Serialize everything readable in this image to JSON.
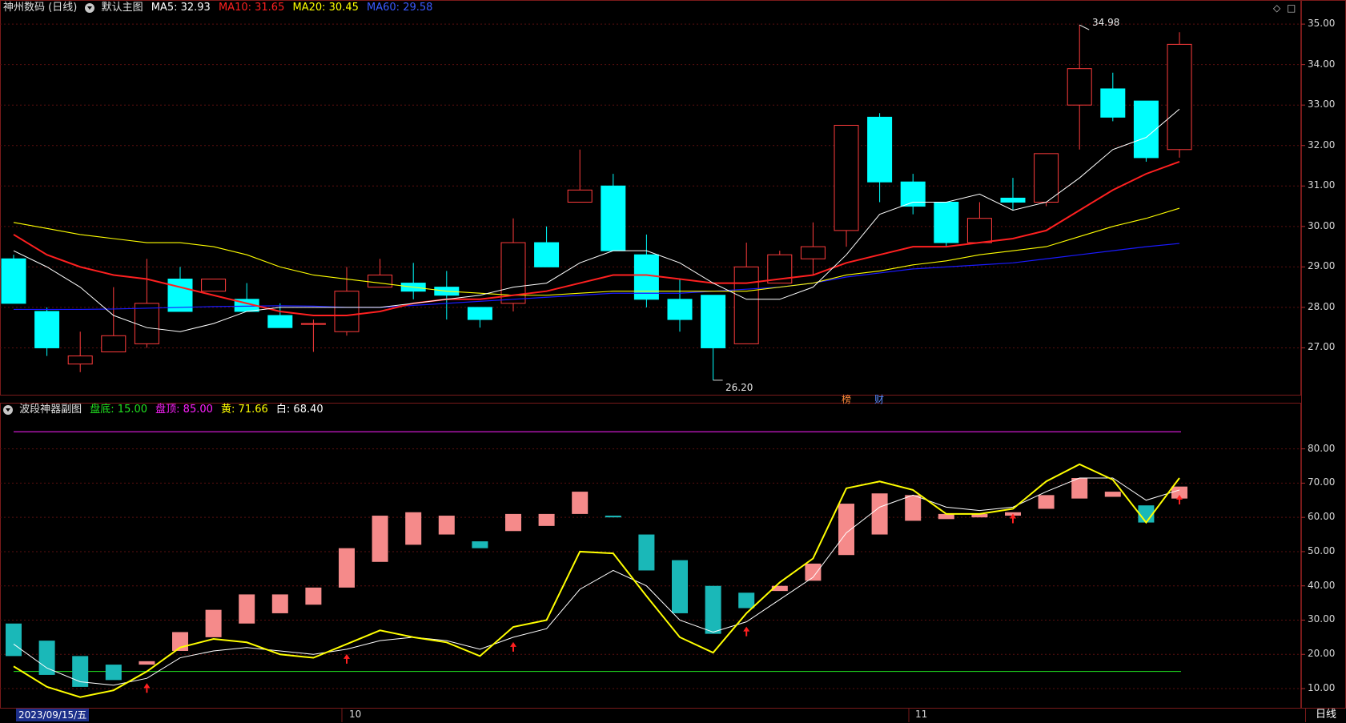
{
  "main_header": {
    "title": "神州数码 (日线)",
    "indicator_name": "默认主图",
    "ma5": {
      "label": "MA5: 32.93",
      "color": "#ffffff"
    },
    "ma10": {
      "label": "MA10: 31.65",
      "color": "#ff2020"
    },
    "ma20": {
      "label": "MA20: 30.45",
      "color": "#ffff00"
    },
    "ma60": {
      "label": "MA60: 29.58",
      "color": "#1a1aff"
    }
  },
  "sub_header": {
    "title": "波段神器副图",
    "bottom": {
      "label": "盘底: 15.00",
      "color": "#20e020"
    },
    "top": {
      "label": "盘顶: 85.00",
      "color": "#ff20ff"
    },
    "yellow": {
      "label": "黄: 71.66",
      "color": "#ffff00"
    },
    "white": {
      "label": "白: 68.40",
      "color": "#ffffff"
    }
  },
  "main_axis_labels": [
    "35.00",
    "34.00",
    "33.00",
    "32.00",
    "31.00",
    "30.00",
    "29.00",
    "28.00",
    "27.00"
  ],
  "sub_axis_labels": [
    "80.00",
    "70.00",
    "60.00",
    "50.00",
    "40.00",
    "30.00",
    "20.00",
    "10.00"
  ],
  "annotations": {
    "high": "34.98",
    "low": "26.20",
    "tag1": "榜",
    "tag2": "财"
  },
  "x_axis": {
    "date_cursor": "2023/09/15/五",
    "month_oct": "10",
    "month_nov": "11"
  },
  "period_button": "日线",
  "corner_icons": [
    "◇",
    "□"
  ],
  "chart_data": [
    {
      "type": "candlestick",
      "candles": [
        {
          "o": 29.2,
          "h": 29.3,
          "l": 28.1,
          "c": 28.1
        },
        {
          "o": 27.9,
          "h": 28.0,
          "l": 26.8,
          "c": 27.0
        },
        {
          "o": 26.6,
          "h": 27.4,
          "l": 26.4,
          "c": 26.8
        },
        {
          "o": 26.9,
          "h": 28.5,
          "l": 26.9,
          "c": 27.3
        },
        {
          "o": 27.1,
          "h": 29.2,
          "l": 27.0,
          "c": 28.1
        },
        {
          "o": 28.7,
          "h": 29.0,
          "l": 27.9,
          "c": 27.9
        },
        {
          "o": 28.4,
          "h": 28.7,
          "l": 28.4,
          "c": 28.7
        },
        {
          "o": 28.2,
          "h": 28.6,
          "l": 27.9,
          "c": 27.9
        },
        {
          "o": 27.8,
          "h": 28.1,
          "l": 27.5,
          "c": 27.5
        },
        {
          "o": 27.6,
          "h": 27.7,
          "l": 26.9,
          "c": 27.6
        },
        {
          "o": 27.4,
          "h": 29.0,
          "l": 27.3,
          "c": 28.4
        },
        {
          "o": 28.5,
          "h": 29.2,
          "l": 28.5,
          "c": 28.8
        },
        {
          "o": 28.6,
          "h": 29.1,
          "l": 28.2,
          "c": 28.4
        },
        {
          "o": 28.5,
          "h": 28.9,
          "l": 27.7,
          "c": 28.3
        },
        {
          "o": 28.0,
          "h": 28.0,
          "l": 27.5,
          "c": 27.7
        },
        {
          "o": 28.1,
          "h": 30.2,
          "l": 27.9,
          "c": 29.6
        },
        {
          "o": 29.6,
          "h": 30.0,
          "l": 29.0,
          "c": 29.0
        },
        {
          "o": 30.6,
          "h": 31.9,
          "l": 30.6,
          "c": 30.9
        },
        {
          "o": 31.0,
          "h": 31.3,
          "l": 29.4,
          "c": 29.4
        },
        {
          "o": 29.3,
          "h": 29.8,
          "l": 28.0,
          "c": 28.2
        },
        {
          "o": 28.2,
          "h": 28.7,
          "l": 27.4,
          "c": 27.7
        },
        {
          "o": 28.3,
          "h": 28.3,
          "l": 26.2,
          "c": 27.0
        },
        {
          "o": 27.1,
          "h": 29.6,
          "l": 27.1,
          "c": 29.0
        },
        {
          "o": 28.6,
          "h": 29.4,
          "l": 28.6,
          "c": 29.3
        },
        {
          "o": 29.2,
          "h": 30.1,
          "l": 28.8,
          "c": 29.5
        },
        {
          "o": 29.9,
          "h": 32.3,
          "l": 29.5,
          "c": 32.5
        },
        {
          "o": 32.7,
          "h": 32.8,
          "l": 30.6,
          "c": 31.1
        },
        {
          "o": 31.1,
          "h": 31.3,
          "l": 30.3,
          "c": 30.5
        },
        {
          "o": 30.6,
          "h": 30.6,
          "l": 29.5,
          "c": 29.6
        },
        {
          "o": 29.6,
          "h": 30.6,
          "l": 29.6,
          "c": 30.2
        },
        {
          "o": 30.7,
          "h": 31.2,
          "l": 30.4,
          "c": 30.6
        },
        {
          "o": 30.6,
          "h": 31.8,
          "l": 30.5,
          "c": 31.8
        },
        {
          "o": 33.0,
          "h": 34.98,
          "l": 31.9,
          "c": 33.9
        },
        {
          "o": 33.4,
          "h": 33.8,
          "l": 32.6,
          "c": 32.7
        },
        {
          "o": 33.1,
          "h": 33.1,
          "l": 31.6,
          "c": 31.7
        },
        {
          "o": 31.9,
          "h": 34.8,
          "l": 31.7,
          "c": 34.5
        }
      ],
      "ma5": [
        29.4,
        29.0,
        28.5,
        27.8,
        27.5,
        27.4,
        27.6,
        27.9,
        28.0,
        28.0,
        28.0,
        28.0,
        28.1,
        28.2,
        28.3,
        28.5,
        28.6,
        29.1,
        29.4,
        29.4,
        29.1,
        28.6,
        28.2,
        28.2,
        28.5,
        29.3,
        30.3,
        30.6,
        30.6,
        30.8,
        30.4,
        30.6,
        31.2,
        31.9,
        32.2,
        32.9
      ],
      "ma10": [
        29.8,
        29.3,
        29.0,
        28.8,
        28.7,
        28.5,
        28.3,
        28.1,
        27.9,
        27.8,
        27.8,
        27.9,
        28.1,
        28.2,
        28.2,
        28.3,
        28.4,
        28.6,
        28.8,
        28.8,
        28.7,
        28.6,
        28.6,
        28.7,
        28.8,
        29.1,
        29.3,
        29.5,
        29.5,
        29.6,
        29.7,
        29.9,
        30.4,
        30.9,
        31.3,
        31.6
      ],
      "ma20": [
        30.1,
        29.95,
        29.8,
        29.7,
        29.6,
        29.6,
        29.5,
        29.3,
        29.0,
        28.8,
        28.7,
        28.6,
        28.5,
        28.4,
        28.35,
        28.3,
        28.3,
        28.35,
        28.4,
        28.4,
        28.4,
        28.4,
        28.4,
        28.5,
        28.6,
        28.8,
        28.9,
        29.05,
        29.15,
        29.3,
        29.4,
        29.5,
        29.75,
        30.0,
        30.2,
        30.45
      ],
      "ma60": [
        27.95,
        27.95,
        27.95,
        27.96,
        27.98,
        28.0,
        28.02,
        28.03,
        28.04,
        28.03,
        28.0,
        28.0,
        28.05,
        28.1,
        28.15,
        28.2,
        28.25,
        28.3,
        28.35,
        28.35,
        28.35,
        28.4,
        28.45,
        28.5,
        28.6,
        28.75,
        28.85,
        28.95,
        29.0,
        29.05,
        29.1,
        29.2,
        29.3,
        29.4,
        29.5,
        29.58
      ],
      "ylim": [
        26.0,
        35.2
      ]
    },
    {
      "type": "bar",
      "bars": [
        {
          "o": 29,
          "c": 19.5
        },
        {
          "o": 24,
          "c": 14
        },
        {
          "o": 19.5,
          "c": 10.5
        },
        {
          "o": 17,
          "c": 12.5
        },
        {
          "o": 17,
          "c": 18
        },
        {
          "o": 21,
          "c": 26.5
        },
        {
          "o": 25,
          "c": 33
        },
        {
          "o": 29,
          "c": 37.5
        },
        {
          "o": 32,
          "c": 37.5
        },
        {
          "o": 34.5,
          "c": 39.5
        },
        {
          "o": 39.5,
          "c": 51
        },
        {
          "o": 47,
          "c": 60.5
        },
        {
          "o": 52,
          "c": 61.5
        },
        {
          "o": 55,
          "c": 60.5
        },
        {
          "o": 53,
          "c": 51
        },
        {
          "o": 56,
          "c": 61
        },
        {
          "o": 57.5,
          "c": 61
        },
        {
          "o": 61,
          "c": 67.5
        },
        {
          "o": 60.5,
          "c": 60
        },
        {
          "o": 55,
          "c": 44.5
        },
        {
          "o": 47.5,
          "c": 32
        },
        {
          "o": 40,
          "c": 26
        },
        {
          "o": 38,
          "c": 33.5
        },
        {
          "o": 38.5,
          "c": 40
        },
        {
          "o": 41.5,
          "c": 46.5
        },
        {
          "o": 49,
          "c": 64
        },
        {
          "o": 55,
          "c": 67
        },
        {
          "o": 59,
          "c": 66.5
        },
        {
          "o": 59.5,
          "c": 61
        },
        {
          "o": 60,
          "c": 61
        },
        {
          "o": 60.5,
          "c": 61.5
        },
        {
          "o": 62.5,
          "c": 66.5
        },
        {
          "o": 65.5,
          "c": 71.5
        },
        {
          "o": 66,
          "c": 67.5
        },
        {
          "o": 63.5,
          "c": 58.5
        },
        {
          "o": 65.5,
          "c": 69
        }
      ],
      "yellow": [
        16.5,
        10.5,
        7.5,
        9.5,
        15,
        22,
        24.5,
        23.5,
        20,
        19,
        23,
        27,
        25,
        23.5,
        19.5,
        28,
        30,
        50,
        49.5,
        37,
        25,
        20.5,
        32,
        41,
        48,
        68.5,
        70.5,
        68,
        61,
        61,
        62.5,
        70.5,
        75.5,
        71,
        58.5,
        71.5
      ],
      "white": [
        23,
        16,
        12,
        11,
        13,
        19,
        21,
        22,
        21,
        20,
        21.5,
        24,
        25,
        24,
        21.5,
        25,
        27.5,
        39,
        44.5,
        40,
        30,
        26.5,
        29.5,
        36,
        42.5,
        55.5,
        63,
        66.5,
        63,
        62,
        63,
        67.5,
        71.5,
        71.5,
        65,
        68
      ],
      "signal_arrows": [
        4,
        10,
        15,
        22,
        30,
        35
      ],
      "reference_lines": {
        "bottom": 15,
        "top": 85
      },
      "ylim": [
        6.5,
        89.5
      ]
    }
  ]
}
